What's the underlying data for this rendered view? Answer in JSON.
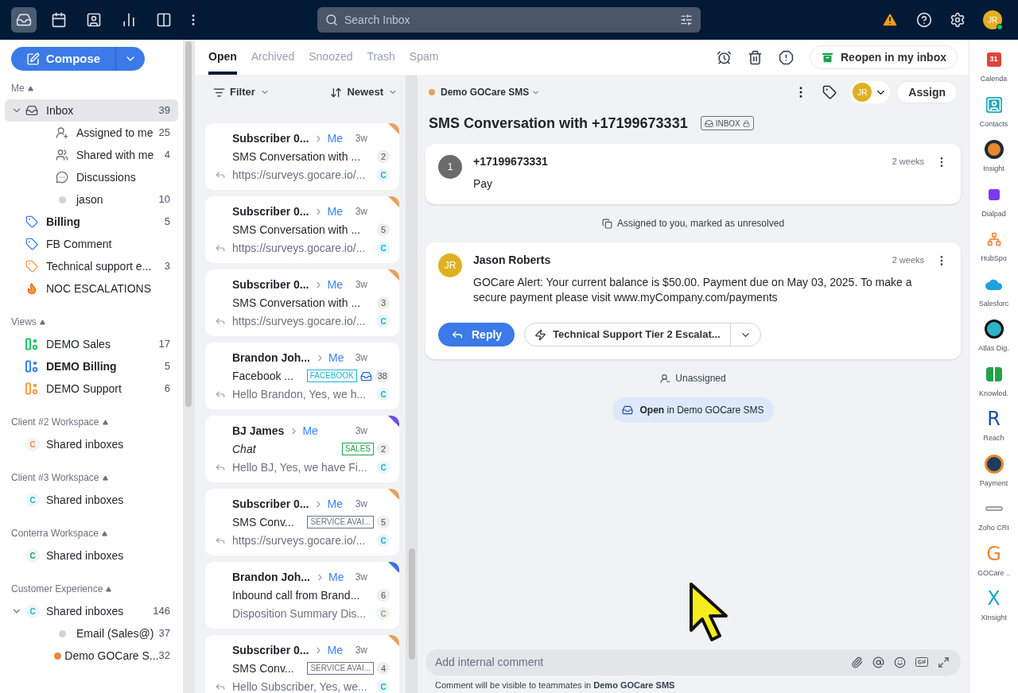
{
  "topbar": {
    "nav": [
      {
        "selected": true
      },
      {
        "selected": false
      },
      {
        "selected": false
      },
      {
        "selected": false
      },
      {
        "selected": false
      }
    ],
    "search": {
      "placeholder": "Search Inbox"
    },
    "avatar": "JR"
  },
  "compose": "Compose",
  "sidebar": [
    {
      "title": "Me",
      "items": [
        {
          "kind": "inbox",
          "label": "Inbox",
          "count": "39",
          "selected": true,
          "bold": false,
          "expanded": true,
          "children": [
            {
              "kind": "assigned",
              "label": "Assigned to me",
              "count": "25",
              "selected": false,
              "bold": false
            },
            {
              "kind": "shared",
              "label": "Shared with me",
              "count": "4",
              "selected": false,
              "bold": false
            },
            {
              "kind": "discussions",
              "label": "Discussions",
              "selected": false,
              "bold": false
            },
            {
              "kind": "dot",
              "label": "jason",
              "count": "10",
              "color": "#d4d4d8",
              "selected": false,
              "bold": false
            }
          ]
        },
        {
          "kind": "tag",
          "label": "Billing",
          "count": "5",
          "color": "#3b82f6",
          "selected": false,
          "bold": true
        },
        {
          "kind": "tag",
          "label": "FB Comment",
          "color": "#3b82f6",
          "selected": false,
          "bold": false
        },
        {
          "kind": "tag",
          "label": "Technical support e...",
          "count": "3",
          "color": "#f59e42",
          "selected": false,
          "bold": false
        },
        {
          "kind": "fire",
          "label": "NOC ESCALATIONS",
          "selected": false,
          "bold": false
        }
      ]
    },
    {
      "title": "Views",
      "items": [
        {
          "kind": "view",
          "label": "DEMO Sales",
          "count": "17",
          "color": "#22c55e",
          "selected": false,
          "bold": false
        },
        {
          "kind": "view",
          "label": "DEMO Billing",
          "count": "5",
          "color": "#3b82f6",
          "selected": false,
          "bold": true
        },
        {
          "kind": "view",
          "label": "DEMO Support",
          "count": "6",
          "color": "#f59e42",
          "selected": false,
          "bold": false
        }
      ]
    },
    {
      "title": "Client #2 Workspace",
      "items": [
        {
          "kind": "workspace",
          "avatar": "C",
          "label": "Shared inboxes",
          "color": "#f08a3c",
          "selected": false,
          "bold": false
        }
      ]
    },
    {
      "title": "Client #3 Workspace",
      "items": [
        {
          "kind": "workspace",
          "avatar": "C",
          "label": "Shared inboxes",
          "color": "#14b8c9",
          "selected": false,
          "bold": false
        }
      ]
    },
    {
      "title": "Conterra Workspace",
      "items": [
        {
          "kind": "workspace",
          "avatar": "C",
          "label": "Shared inboxes",
          "color": "#22a34a",
          "selected": false,
          "bold": false
        }
      ]
    },
    {
      "title": "Customer Experience",
      "items": [
        {
          "kind": "workspace",
          "avatar": "C",
          "label": "Shared inboxes",
          "count": "146",
          "color": "#14b8c9",
          "selected": false,
          "bold": false,
          "expanded": true,
          "children": [
            {
              "kind": "dot",
              "label": "Email (Sales@)",
              "count": "37",
              "color": "#d4d4d8",
              "selected": false,
              "bold": false
            },
            {
              "kind": "dot",
              "label": "Demo GOCare S...",
              "count": "32",
              "color": "#e8893a",
              "selected": false,
              "bold": false
            }
          ]
        }
      ]
    }
  ],
  "tabs": [
    {
      "label": "Open",
      "selected": true
    },
    {
      "label": "Archived",
      "selected": false
    },
    {
      "label": "Snoozed",
      "selected": false
    },
    {
      "label": "Trash",
      "selected": false
    },
    {
      "label": "Spam",
      "selected": false
    }
  ],
  "reopen": "Reopen in my inbox",
  "list": {
    "filter": "Filter",
    "sort": "Newest",
    "conversations": [
      {
        "sender": "Subscriber 0...",
        "assignee": "Me",
        "time": "3w",
        "subject": "SMS Conversation with ...",
        "italic": false,
        "count": "2",
        "preview": "https://surveys.gocare.io/...",
        "replied": true,
        "avatar": {
          "label": "C",
          "color": "#14b8c9"
        },
        "color": "#e8a05a",
        "channel_icon": false
      },
      {
        "sender": "Subscriber 0...",
        "assignee": "Me",
        "time": "3w",
        "subject": "SMS Conversation with ...",
        "italic": false,
        "count": "5",
        "preview": "https://surveys.gocare.io/...",
        "replied": true,
        "avatar": {
          "label": "C",
          "color": "#14b8c9"
        },
        "color": "#e8a05a",
        "channel_icon": false
      },
      {
        "sender": "Subscriber 0...",
        "assignee": "Me",
        "time": "3w",
        "subject": "SMS Conversation with ...",
        "italic": false,
        "count": "3",
        "preview": "https://surveys.gocare.io/...",
        "replied": true,
        "avatar": {
          "label": "C",
          "color": "#14b8c9"
        },
        "color": "#e8a05a",
        "channel_icon": false
      },
      {
        "sender": "Brandon Joh...",
        "assignee": "Me",
        "time": "3w",
        "subject": "Facebook ...",
        "italic": false,
        "tag": {
          "label": "FACEBOOK",
          "color": "#19b5d8"
        },
        "count": "38",
        "preview": "Hello Brandon, Yes, we h...",
        "replied": true,
        "avatar": {
          "label": "C",
          "color": "#14b8c9"
        },
        "channel_icon": true
      },
      {
        "sender": "BJ James",
        "assignee": "Me",
        "time": "3w",
        "subject": "Chat",
        "italic": true,
        "tag": {
          "label": "SALES",
          "color": "#22a34a"
        },
        "count": "2",
        "preview": "Hello BJ, Yes, we have Fi...",
        "replied": true,
        "avatar": {
          "label": "C",
          "color": "#14b8c9"
        },
        "color": "#6d4ee0",
        "channel_icon": false
      },
      {
        "sender": "Subscriber 0...",
        "assignee": "Me",
        "time": "3w",
        "subject": "SMS Conv...",
        "italic": false,
        "tag": {
          "label": "SERVICE AVAI...",
          "color": "#6b7280"
        },
        "count": "5",
        "preview": "https://surveys.gocare.io/...",
        "replied": true,
        "avatar": {
          "label": "C",
          "color": "#14b8c9"
        },
        "color": "#e8a05a",
        "channel_icon": false
      },
      {
        "sender": "Brandon Joh...",
        "assignee": "Me",
        "time": "3w",
        "subject": "Inbound call from Brand...",
        "italic": false,
        "count": "6",
        "preview": "Disposition Summary Dis...",
        "replied": false,
        "avatar": {
          "label": "C",
          "color": "#f08a3c"
        },
        "color": "#3b6fe0",
        "channel_icon": false
      },
      {
        "sender": "Subscriber 0...",
        "assignee": "Me",
        "time": "3w",
        "subject": "SMS Conv...",
        "italic": false,
        "tag": {
          "label": "SERVICE AVAI...",
          "color": "#6b7280"
        },
        "count": "4",
        "preview": "Hello Subscriber, Yes, we...",
        "replied": true,
        "avatar": {
          "label": "C",
          "color": "#14b8c9"
        },
        "color": "#e8a05a",
        "channel_icon": false
      }
    ]
  },
  "conversation": {
    "inbox": {
      "label": "Demo GOCare SMS",
      "color": "#e8a05a"
    },
    "assignee_avatar": "JR",
    "assign": "Assign",
    "title": "SMS Conversation with +17199673331",
    "badge": "INBOX",
    "timeline": [
      {
        "kind": "message",
        "avatar": {
          "label": "1",
          "color": "#6b6b6b"
        },
        "author": "+17199673331",
        "time": "2 weeks",
        "body": "Pay"
      },
      {
        "kind": "assign_event",
        "text": "Assigned to you, marked as unresolved"
      },
      {
        "kind": "message",
        "avatar": {
          "label": "JR",
          "color": "#e0b020"
        },
        "author": "Jason Roberts",
        "time": "2 weeks",
        "body": "GOCare Alert: Your current balance is $50.00. Payment due on May 03, 2025. To make a secure payment please visit www.myCompany.com/payments",
        "reply": "Reply",
        "macro": "Technical Support Tier 2 Escalat..."
      },
      {
        "kind": "unassign_event",
        "text": "Unassigned"
      },
      {
        "kind": "status",
        "text": "**Open** in Demo GOCare SMS"
      }
    ],
    "comment": {
      "placeholder": "Add internal comment",
      "note": "Comment will be visible to teammates in **Demo GOCare SMS**"
    }
  },
  "apps": [
    {
      "label": "Calenda",
      "kind": "glyph",
      "glyph": "31",
      "color": "#e0453a"
    },
    {
      "label": "Contacts",
      "kind": "contact",
      "color": "#1ea8b8"
    },
    {
      "label": "Insight",
      "kind": "ring",
      "color": "#e8892a"
    },
    {
      "label": "Dialpad",
      "kind": "square",
      "color": "#7c3aed"
    },
    {
      "label": "HubSpo",
      "kind": "hub",
      "color": "#f07b2e"
    },
    {
      "label": "Salesforc",
      "kind": "cloud",
      "color": "#1ea0e0"
    },
    {
      "label": "Atlas Dig.",
      "kind": "circle",
      "color": "#2bb5c5"
    },
    {
      "label": "Knowled.",
      "kind": "book",
      "color": "#22a34a"
    },
    {
      "label": "Reach",
      "kind": "glyph",
      "glyph": "R",
      "color": "#1d4fb0"
    },
    {
      "label": "Payment",
      "kind": "coin",
      "color": "#e8892a"
    },
    {
      "label": "Zoho CRI",
      "kind": "chain",
      "color": "#9ca3af"
    },
    {
      "label": "GOCare ..",
      "kind": "glyph",
      "glyph": "G",
      "color": "#e8892a"
    },
    {
      "label": "XInsight",
      "kind": "glyph",
      "glyph": "X",
      "color": "#1aa5c8"
    }
  ]
}
